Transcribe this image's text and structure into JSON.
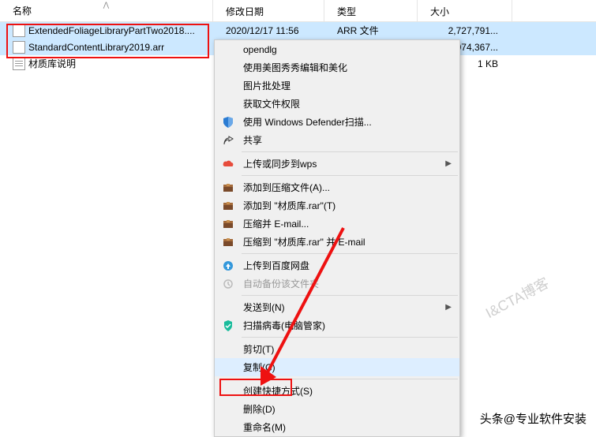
{
  "headers": {
    "name": "名称",
    "date": "修改日期",
    "type": "类型",
    "size": "大小"
  },
  "files": [
    {
      "name": "ExtendedFoliageLibraryPartTwo2018....",
      "date": "2020/12/17 11:56",
      "type": "ARR 文件",
      "size": "2,727,791..."
    },
    {
      "name": "StandardContentLibrary2019.arr",
      "date": "",
      "type": "",
      "size": "074,367..."
    },
    {
      "name": "材质库说明",
      "date": "",
      "type": "",
      "size": "1 KB"
    }
  ],
  "menu": {
    "opendlg": "opendlg",
    "meitu": "使用美图秀秀编辑和美化",
    "batch": "图片批处理",
    "permission": "获取文件权限",
    "defender": "使用 Windows Defender扫描...",
    "share": "共享",
    "wps_upload": "上传或同步到wps",
    "rar_add": "添加到压缩文件(A)...",
    "rar_add_named": "添加到 \"材质库.rar\"(T)",
    "rar_email": "压缩并 E-mail...",
    "rar_email_named": "压缩到 \"材质库.rar\" 并 E-mail",
    "baidu": "上传到百度网盘",
    "auto_backup": "自动备份该文件夹",
    "send_to": "发送到(N)",
    "scan_virus": "扫描病毒(电脑管家)",
    "cut": "剪切(T)",
    "copy": "复制(C)",
    "shortcut": "创建快捷方式(S)",
    "delete": "删除(D)",
    "rename": "重命名(M)"
  },
  "watermark1": "I&CTA博客",
  "watermark2": "头条@专业软件安装"
}
